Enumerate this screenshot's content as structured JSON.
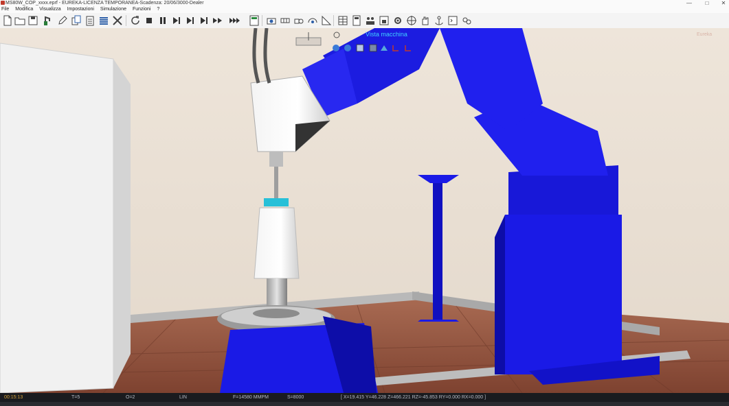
{
  "window": {
    "title": "MS80W_COP_xxxx.eprf - EUREKA-LICENZA TEMPORANEA-Scadenza: 20/06/3000-Dealer",
    "controls": [
      "—",
      "□",
      "✕"
    ]
  },
  "menu": [
    "File",
    "Modifica",
    "Visualizza",
    "Impostazioni",
    "Simulazione",
    "Funzioni",
    "?"
  ],
  "toolbar": {
    "icons": [
      "new-file-icon",
      "open-folder-icon",
      "save-icon",
      "robot-config-icon",
      "pen-icon",
      "copy-icon",
      "clipboard-icon",
      "layers-icon",
      "tools-icon",
      "reset-icon",
      "stop-icon",
      "pause-icon",
      "step-icon",
      "step-back-icon",
      "step-forward-icon",
      "fast-forward-icon",
      "skip-end-icon",
      "program-icon",
      "camera-icon",
      "grid-view-icon",
      "collision-icon",
      "measure-icon",
      "table-icon",
      "calculator-icon",
      "people-icon",
      "export-icon",
      "sensor-icon",
      "target-icon",
      "hand-icon",
      "anchor-icon",
      "terminal-icon",
      "settings-gear-icon"
    ]
  },
  "viewport": {
    "view_label": "Vista macchina",
    "brand": "Eureka",
    "view_buttons": [
      "move-view-icon",
      "zoom-view-icon",
      "fit-view-icon",
      "rotate-view-icon",
      "axis-x-icon",
      "axis-y-icon"
    ]
  },
  "status": {
    "time": "00:15:13",
    "tool": "T=5",
    "origin": "O=2",
    "motion": "LIN",
    "feed": "F=14580 MMPM",
    "speed": "S=8000",
    "coords": "[ X=19.415 Y=46.228 Z=466.221 RZ=-45.853 RY=0.000 RX=0.000 ]"
  },
  "colors": {
    "robot_blue": "#1a1ae6",
    "wall": "#efe6dc",
    "floor": "#9b5a43",
    "status_bg": "#1a1b1f"
  }
}
